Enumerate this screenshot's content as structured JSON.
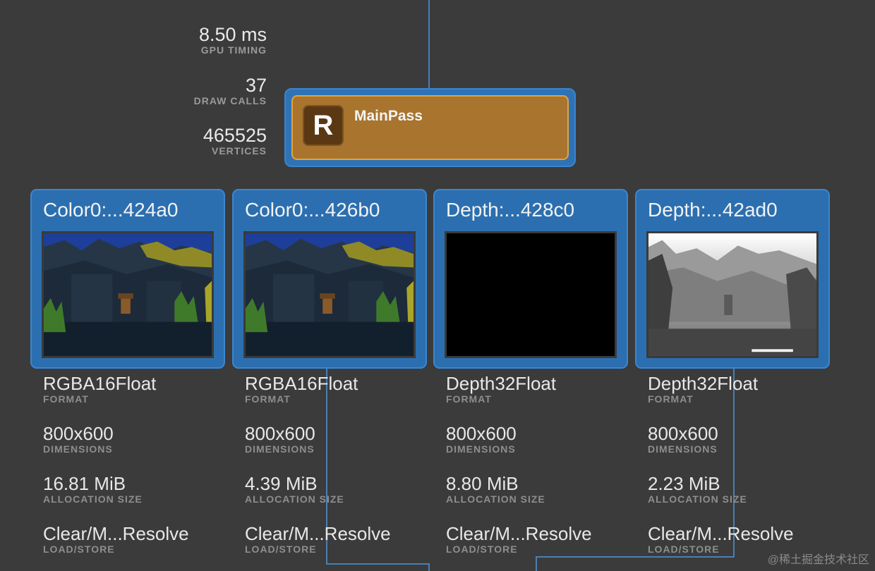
{
  "stats": [
    {
      "value": "8.50 ms",
      "label": "GPU TIMING"
    },
    {
      "value": "37",
      "label": "DRAW CALLS"
    },
    {
      "value": "465525",
      "label": "VERTICES"
    }
  ],
  "pass": {
    "icon_letter": "R",
    "name": "MainPass",
    "icon": "render-pass-icon"
  },
  "attachments": [
    {
      "title": "Color0:...424a0",
      "thumbnail": "color-scene",
      "format": "RGBA16Float",
      "format_label": "FORMAT",
      "dimensions": "800x600",
      "dimensions_label": "DIMENSIONS",
      "allocation": "16.81 MiB",
      "allocation_label": "ALLOCATION SIZE",
      "loadstore": "Clear/M...Resolve",
      "loadstore_label": "LOAD/STORE"
    },
    {
      "title": "Color0:...426b0",
      "thumbnail": "color-scene",
      "format": "RGBA16Float",
      "format_label": "FORMAT",
      "dimensions": "800x600",
      "dimensions_label": "DIMENSIONS",
      "allocation": "4.39 MiB",
      "allocation_label": "ALLOCATION SIZE",
      "loadstore": "Clear/M...Resolve",
      "loadstore_label": "LOAD/STORE"
    },
    {
      "title": "Depth:...428c0",
      "thumbnail": "depth-black",
      "format": "Depth32Float",
      "format_label": "FORMAT",
      "dimensions": "800x600",
      "dimensions_label": "DIMENSIONS",
      "allocation": "8.80 MiB",
      "allocation_label": "ALLOCATION SIZE",
      "loadstore": "Clear/M...Resolve",
      "loadstore_label": "LOAD/STORE"
    },
    {
      "title": "Depth:...42ad0",
      "thumbnail": "depth-gray",
      "format": "Depth32Float",
      "format_label": "FORMAT",
      "dimensions": "800x600",
      "dimensions_label": "DIMENSIONS",
      "allocation": "2.23 MiB",
      "allocation_label": "ALLOCATION SIZE",
      "loadstore": "Clear/M...Resolve",
      "loadstore_label": "LOAD/STORE"
    }
  ],
  "watermark": "@稀土掘金技术社区",
  "colors": {
    "background": "#3b3b3b",
    "selection": "#2c6fb0",
    "pass_fill": "#a8742e",
    "pass_border": "#e2a23e",
    "wire": "#4a7fb5"
  }
}
